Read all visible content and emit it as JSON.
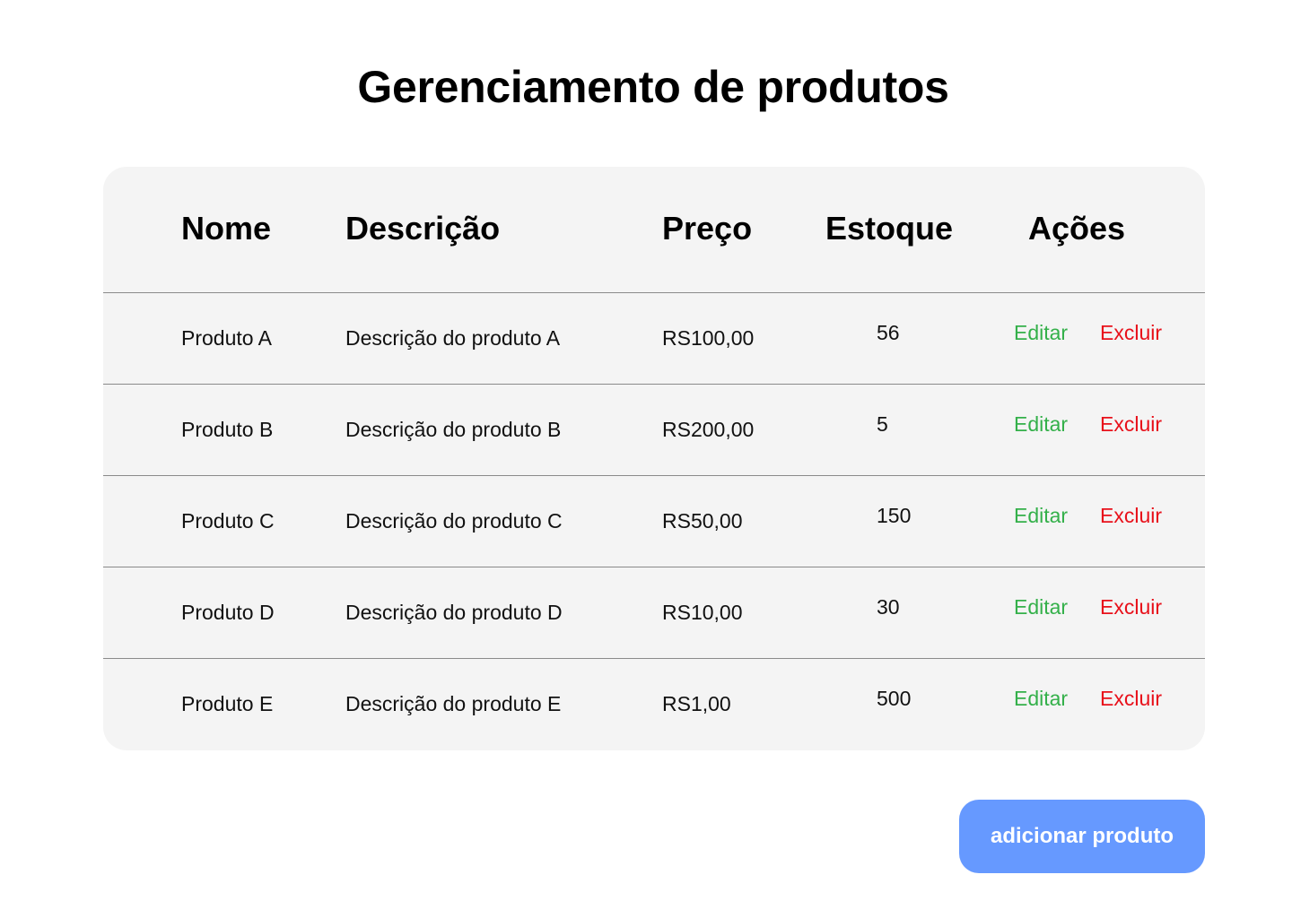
{
  "page": {
    "title": "Gerenciamento de produtos"
  },
  "table": {
    "headers": {
      "nome": "Nome",
      "descricao": "Descrição",
      "preco": "Preço",
      "estoque": "Estoque",
      "acoes": "Ações"
    },
    "rows": [
      {
        "nome": "Produto A",
        "descricao": "Descrição do produto A",
        "preco": "RS100,00",
        "estoque": "56",
        "edit": "Editar",
        "delete": "Excluir"
      },
      {
        "nome": "Produto B",
        "descricao": "Descrição do produto B",
        "preco": "RS200,00",
        "estoque": "5",
        "edit": "Editar",
        "delete": "Excluir"
      },
      {
        "nome": "Produto C",
        "descricao": "Descrição do produto C",
        "preco": "RS50,00",
        "estoque": "150",
        "edit": "Editar",
        "delete": "Excluir"
      },
      {
        "nome": "Produto D",
        "descricao": "Descrição do produto D",
        "preco": "RS10,00",
        "estoque": "30",
        "edit": "Editar",
        "delete": "Excluir"
      },
      {
        "nome": "Produto E",
        "descricao": "Descrição do produto E",
        "preco": "RS1,00",
        "estoque": "500",
        "edit": "Editar",
        "delete": "Excluir"
      }
    ]
  },
  "actions": {
    "add_product_label": "adicionar produto"
  },
  "colors": {
    "edit": "#34b04a",
    "delete": "#e8101a",
    "primary_button": "#6699ff",
    "table_background": "#f4f4f4"
  }
}
